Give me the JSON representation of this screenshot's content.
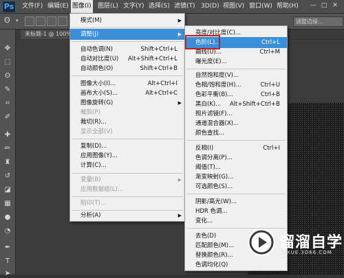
{
  "app": {
    "logo": "Ps"
  },
  "menubar": {
    "items": [
      "文件(F)",
      "编辑(E)",
      "图像(I)",
      "图层(L)",
      "文字(Y)",
      "选择(S)",
      "滤镜(T)",
      "3D(D)",
      "视图(V)",
      "窗口(W)",
      "帮助(H)"
    ],
    "active": "图像(I)"
  },
  "options_bar": {
    "field_label": "调整边缘..."
  },
  "document_tab": {
    "label": "未标题-1 @ 100%"
  },
  "image_menu": {
    "items": [
      {
        "label": "模式(M)",
        "shortcut": "",
        "submenu": true,
        "disabled": false
      },
      {
        "label": "调整(J)",
        "shortcut": "",
        "submenu": true,
        "disabled": false,
        "highlighted": true
      },
      {
        "label": "自动色调(N)",
        "shortcut": "Shift+Ctrl+L",
        "disabled": false
      },
      {
        "label": "自动对比度(U)",
        "shortcut": "Alt+Shift+Ctrl+L",
        "disabled": false
      },
      {
        "label": "自动颜色(O)",
        "shortcut": "Shift+Ctrl+B",
        "disabled": false
      },
      {
        "label": "图像大小(I)...",
        "shortcut": "Alt+Ctrl+I",
        "disabled": false
      },
      {
        "label": "画布大小(S)...",
        "shortcut": "Alt+Ctrl+C",
        "disabled": false
      },
      {
        "label": "图像旋转(G)",
        "shortcut": "",
        "submenu": true,
        "disabled": false
      },
      {
        "label": "裁剪(P)",
        "shortcut": "",
        "disabled": true
      },
      {
        "label": "裁切(R)...",
        "shortcut": "",
        "disabled": false
      },
      {
        "label": "显示全部(V)",
        "shortcut": "",
        "disabled": true
      },
      {
        "label": "复制(D)...",
        "shortcut": "",
        "disabled": false
      },
      {
        "label": "应用图像(Y)...",
        "shortcut": "",
        "disabled": false
      },
      {
        "label": "计算(C)...",
        "shortcut": "",
        "disabled": false
      },
      {
        "label": "变量(B)",
        "shortcut": "",
        "submenu": true,
        "disabled": true
      },
      {
        "label": "应用数据组(L)...",
        "shortcut": "",
        "disabled": true
      },
      {
        "label": "陷印(T)...",
        "shortcut": "",
        "disabled": true
      },
      {
        "label": "分析(A)",
        "shortcut": "",
        "submenu": true,
        "disabled": false
      }
    ]
  },
  "adjust_submenu": {
    "items": [
      {
        "label": "亮度/对比度(C)...",
        "shortcut": ""
      },
      {
        "label": "色阶(L)...",
        "shortcut": "Ctrl+L",
        "highlighted": true,
        "boxed": true
      },
      {
        "label": "曲线(U)...",
        "shortcut": "Ctrl+M"
      },
      {
        "label": "曝光度(E)...",
        "shortcut": ""
      },
      {
        "label": "自然饱和度(V)...",
        "shortcut": ""
      },
      {
        "label": "色相/饱和度(H)...",
        "shortcut": "Ctrl+U"
      },
      {
        "label": "色彩平衡(B)...",
        "shortcut": "Ctrl+B"
      },
      {
        "label": "黑白(K)...",
        "shortcut": "Alt+Shift+Ctrl+B"
      },
      {
        "label": "照片滤镜(F)...",
        "shortcut": ""
      },
      {
        "label": "通道混合器(X)...",
        "shortcut": ""
      },
      {
        "label": "颜色查找...",
        "shortcut": ""
      },
      {
        "label": "反相(I)",
        "shortcut": "Ctrl+I"
      },
      {
        "label": "色调分离(P)...",
        "shortcut": ""
      },
      {
        "label": "阈值(T)...",
        "shortcut": ""
      },
      {
        "label": "渐变映射(G)...",
        "shortcut": ""
      },
      {
        "label": "可选颜色(S)...",
        "shortcut": ""
      },
      {
        "label": "阴影/高光(W)...",
        "shortcut": ""
      },
      {
        "label": "HDR 色调...",
        "shortcut": ""
      },
      {
        "label": "变化...",
        "shortcut": ""
      },
      {
        "label": "去色(D)",
        "shortcut": ""
      },
      {
        "label": "匹配颜色(M)...",
        "shortcut": ""
      },
      {
        "label": "替换颜色(R)...",
        "shortcut": ""
      },
      {
        "label": "色调均化(Q)",
        "shortcut": ""
      }
    ]
  },
  "watermark": {
    "brand": "溜溜自学",
    "url": "ZIXUE.3D66.COM"
  },
  "colors": {
    "highlight": "#3b8fd9",
    "redbox": "#d11a1a",
    "menu_bg": "#f0f0f0"
  }
}
